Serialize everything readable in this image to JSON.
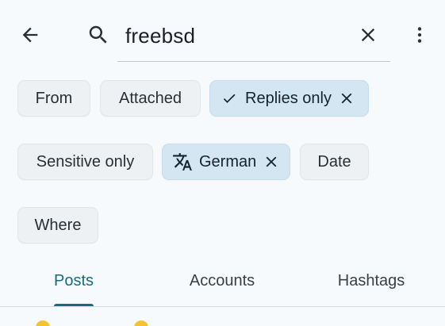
{
  "search": {
    "query": "freebsd",
    "back_icon": "arrow-back-icon",
    "search_icon": "search-icon",
    "clear_icon": "close-icon",
    "more_icon": "more-vert-icon"
  },
  "filters": {
    "row1": [
      {
        "label": "From",
        "selected": false
      },
      {
        "label": "Attached",
        "selected": false
      },
      {
        "label": "Replies only",
        "selected": true
      }
    ],
    "row2": [
      {
        "label": "Sensitive only",
        "selected": false
      },
      {
        "label": "German",
        "selected": true
      },
      {
        "label": "Date",
        "selected": false
      }
    ],
    "row3": [
      {
        "label": "Where",
        "selected": false
      }
    ]
  },
  "tabs": [
    {
      "label": "Posts",
      "active": true
    },
    {
      "label": "Accounts",
      "active": false
    },
    {
      "label": "Hashtags",
      "active": false
    }
  ],
  "colors": {
    "background": "#f6fafc",
    "chip_bg": "#edf1f3",
    "chip_selected_bg": "#d3e6f1",
    "accent": "#166b7e"
  }
}
